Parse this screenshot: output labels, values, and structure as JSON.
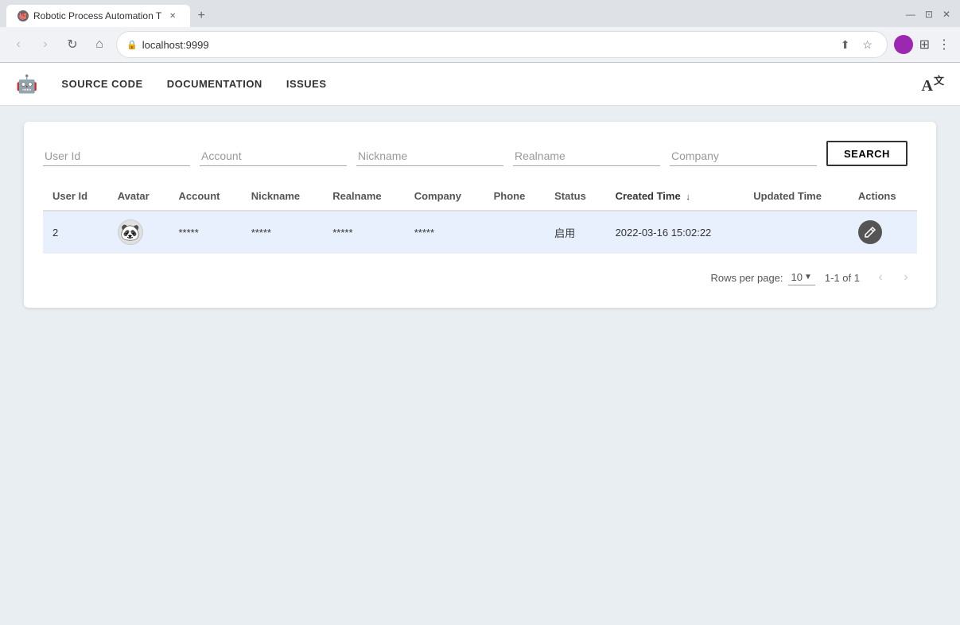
{
  "browser": {
    "tab_title": "Robotic Process Automation T",
    "tab_favicon": "🐙",
    "url": "localhost:9999",
    "new_tab_icon": "+",
    "nav": {
      "back": "‹",
      "forward": "›",
      "refresh": "↻",
      "home": "⌂"
    }
  },
  "app": {
    "logo": "🤖",
    "title": "Robotic Process Automation",
    "nav_items": [
      {
        "label": "SOURCE CODE",
        "id": "source-code"
      },
      {
        "label": "DOCUMENTATION",
        "id": "documentation"
      },
      {
        "label": "ISSUES",
        "id": "issues"
      }
    ],
    "translate_icon": "A"
  },
  "search": {
    "fields": [
      {
        "id": "user-id",
        "placeholder": "User Id",
        "value": ""
      },
      {
        "id": "account",
        "placeholder": "Account",
        "value": ""
      },
      {
        "id": "nickname",
        "placeholder": "Nickname",
        "value": ""
      },
      {
        "id": "realname",
        "placeholder": "Realname",
        "value": ""
      },
      {
        "id": "company",
        "placeholder": "Company",
        "value": ""
      }
    ],
    "button_label": "SEARCH"
  },
  "table": {
    "columns": [
      {
        "id": "user-id",
        "label": "User Id",
        "sortable": false
      },
      {
        "id": "avatar",
        "label": "Avatar",
        "sortable": false
      },
      {
        "id": "account",
        "label": "Account",
        "sortable": false
      },
      {
        "id": "nickname",
        "label": "Nickname",
        "sortable": false
      },
      {
        "id": "realname",
        "label": "Realname",
        "sortable": false
      },
      {
        "id": "company",
        "label": "Company",
        "sortable": false
      },
      {
        "id": "phone",
        "label": "Phone",
        "sortable": false
      },
      {
        "id": "status",
        "label": "Status",
        "sortable": false
      },
      {
        "id": "created-time",
        "label": "Created Time",
        "sortable": true,
        "sort_dir": "↓"
      },
      {
        "id": "updated-time",
        "label": "Updated Time",
        "sortable": false
      },
      {
        "id": "actions",
        "label": "Actions",
        "sortable": false
      }
    ],
    "rows": [
      {
        "user_id": "2",
        "avatar": "🐼",
        "account": "*****",
        "nickname": "*****",
        "realname": "*****",
        "company": "*****",
        "phone": "",
        "status": "启用",
        "created_time": "2022-03-16 15:02:22",
        "updated_time": "",
        "action_icon": "✏"
      }
    ]
  },
  "pagination": {
    "rows_per_page_label": "Rows per page:",
    "rows_per_page_value": "10",
    "page_info": "1-1 of 1",
    "prev_icon": "‹",
    "next_icon": "›"
  }
}
